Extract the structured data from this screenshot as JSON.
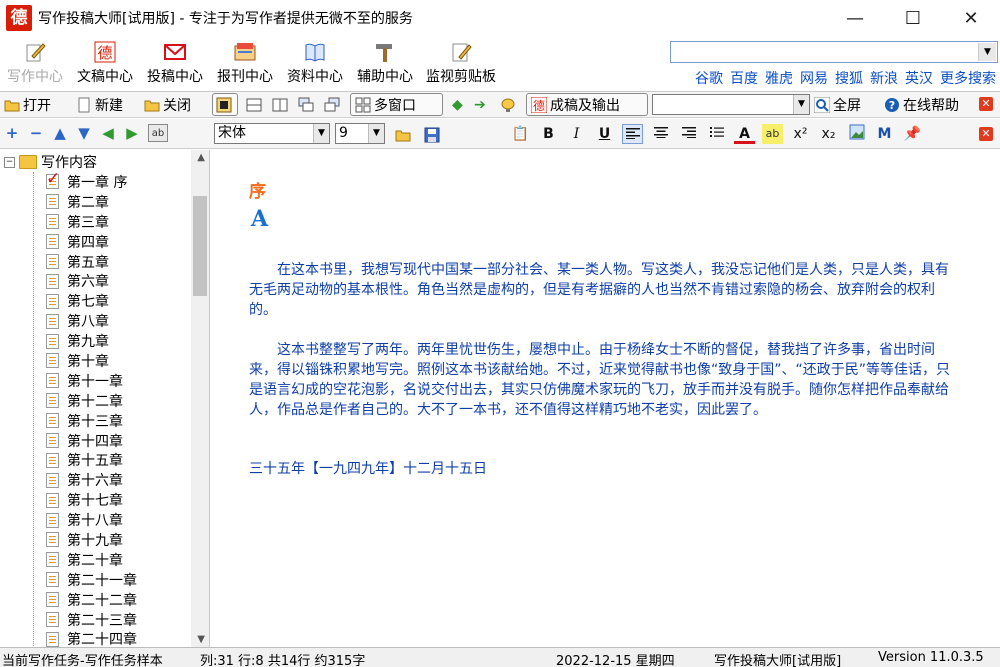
{
  "window": {
    "logo_char": "德",
    "title": "写作投稿大师[试用版] - 专注于为写作者提供无微不至的服务"
  },
  "main_menu": [
    {
      "label": "写作中心",
      "icon": "pen-paper-icon",
      "state": "disabled"
    },
    {
      "label": "文稿中心",
      "icon": "de-logo-icon"
    },
    {
      "label": "投稿中心",
      "icon": "mail-icon"
    },
    {
      "label": "报刊中心",
      "icon": "newspaper-icon"
    },
    {
      "label": "资料中心",
      "icon": "book-icon"
    },
    {
      "label": "辅助中心",
      "icon": "tools-icon"
    },
    {
      "label": "监视剪贴板",
      "icon": "clipboard-icon"
    }
  ],
  "search": {
    "input_value": "",
    "links": [
      "谷歌",
      "百度",
      "雅虎",
      "网易",
      "搜狐",
      "新浪",
      "英汉",
      "更多搜索"
    ]
  },
  "toolbar": {
    "open": "打开",
    "new": "新建",
    "close": "关闭",
    "multi_window": "多窗口",
    "export": "成稿及输出",
    "fullscreen": "全屏",
    "help": "在线帮助"
  },
  "format": {
    "font": "宋体",
    "size": "9",
    "bold": "B",
    "italic": "I",
    "underline": "U",
    "superscript": "x²",
    "subscript": "x₂"
  },
  "tree": {
    "root": "写作内容",
    "items": [
      "第一章 序",
      "第二章",
      "第三章",
      "第四章",
      "第五章",
      "第六章",
      "第七章",
      "第八章",
      "第九章",
      "第十章",
      "第十一章",
      "第十二章",
      "第十三章",
      "第十四章",
      "第十五章",
      "第十六章",
      "第十七章",
      "第十八章",
      "第十九章",
      "第二十章",
      "第二十一章",
      "第二十二章",
      "第二十三章",
      "第二十四章"
    ],
    "checked_index": 0
  },
  "editor": {
    "title": "序",
    "glyph": "A",
    "paragraphs": [
      "在这本书里，我想写现代中国某一部分社会、某一类人物。写这类人，我没忘记他们是人类，只是人类，具有无毛两足动物的基本根性。角色当然是虚构的，但是有考据癖的人也当然不肯错过索隐的杨会、放弃附会的权利的。",
      "这本书整整写了两年。两年里忧世伤生，屡想中止。由于杨绛女士不断的督促，替我挡了许多事，省出时间来，得以锱铢积累地写完。照例这本书该献给她。不过，近来觉得献书也像“致身于国”、“还政于民”等等佳话，只是语言幻成的空花泡影，名说交付出去，其实只仿佛魔术家玩的飞刀，放手而并没有脱手。随你怎样把作品奉献给人，作品总是作者自己的。大不了一本书，还不值得这样精巧地不老实，因此罢了。"
    ],
    "date_line": "三十五年【一九四九年】十二月十五日"
  },
  "status": {
    "task": "当前写作任务-写作任务样本",
    "position": "列:31 行:8 共14行 约315字",
    "date": "2022-12-15 星期四",
    "app": "写作投稿大师[试用版]",
    "version": "Version 11.0.3.5"
  }
}
